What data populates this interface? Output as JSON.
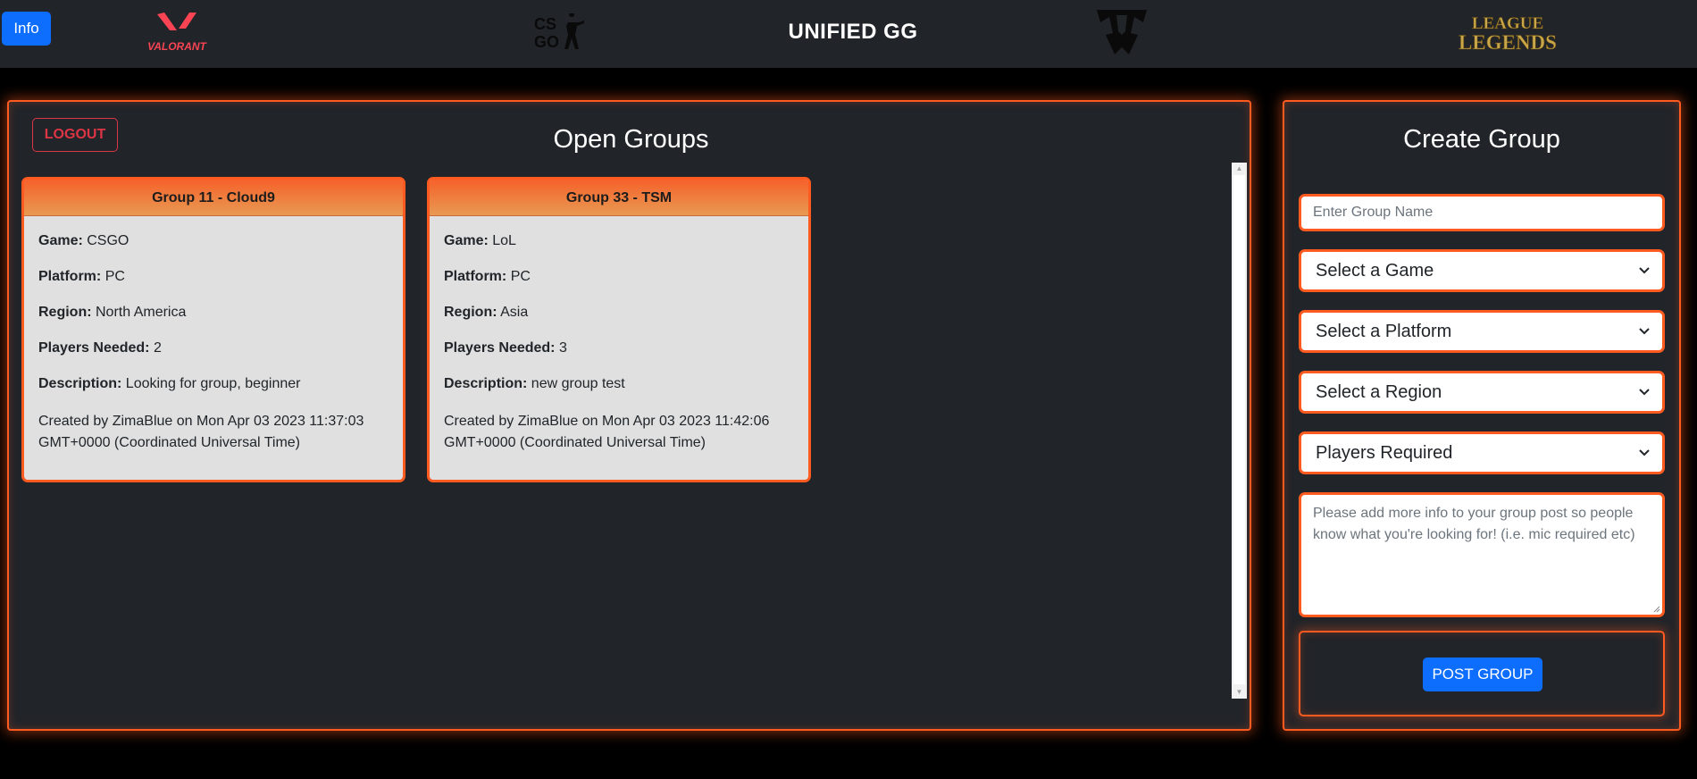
{
  "header": {
    "info_label": "Info",
    "brand_title": "UNIFIED GG",
    "logos": {
      "valorant": "VALORANT",
      "csgo_top": "CS",
      "csgo_bottom": "GO",
      "lol_top": "LEAGUE",
      "lol_bottom": "LEGENDS"
    }
  },
  "groups_panel": {
    "logout_label": "LOGOUT",
    "title": "Open Groups",
    "groups": [
      {
        "header": "Group 11 - Cloud9",
        "game_label": "Game:",
        "game": "CSGO",
        "platform_label": "Platform:",
        "platform": "PC",
        "region_label": "Region:",
        "region": "North America",
        "players_label": "Players Needed:",
        "players": "2",
        "description_label": "Description:",
        "description": "Looking for group, beginner",
        "created": "Created by ZimaBlue on Mon Apr 03 2023 11:37:03 GMT+0000 (Coordinated Universal Time)"
      },
      {
        "header": "Group 33 - TSM",
        "game_label": "Game:",
        "game": "LoL",
        "platform_label": "Platform:",
        "platform": "PC",
        "region_label": "Region:",
        "region": "Asia",
        "players_label": "Players Needed:",
        "players": "3",
        "description_label": "Description:",
        "description": "new group test",
        "created": "Created by ZimaBlue on Mon Apr 03 2023 11:42:06 GMT+0000 (Coordinated Universal Time)"
      }
    ]
  },
  "create_panel": {
    "title": "Create Group",
    "name_placeholder": "Enter Group Name",
    "game_select": "Select a Game",
    "platform_select": "Select a Platform",
    "region_select": "Select a Region",
    "players_select": "Players Required",
    "description_placeholder": "Please add more info to your group post so people know what you're looking for! (i.e. mic required etc)",
    "post_label": "POST GROUP"
  },
  "colors": {
    "accent": "#ff5a1f",
    "panel_bg": "#212429",
    "primary_button": "#0d6efd",
    "danger": "#dc3545"
  }
}
